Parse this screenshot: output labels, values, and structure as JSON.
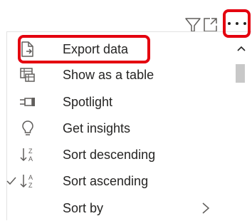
{
  "toolbar": {
    "filter_icon": "filter-icon",
    "focus_icon": "focus-mode-icon",
    "more_icon": "more-options-icon"
  },
  "menu": {
    "items": [
      {
        "label": "Export data",
        "icon": "export-data-icon"
      },
      {
        "label": "Show as a table",
        "icon": "show-as-table-icon"
      },
      {
        "label": "Spotlight",
        "icon": "spotlight-icon"
      },
      {
        "label": "Get insights",
        "icon": "lightbulb-icon"
      },
      {
        "label": "Sort descending",
        "icon": "sort-descending-icon"
      },
      {
        "label": "Sort ascending",
        "icon": "sort-ascending-icon",
        "checked": true
      },
      {
        "label": "Sort by",
        "icon": "",
        "submenu": true
      }
    ]
  },
  "colors": {
    "highlight": "#e4000f",
    "text": "#252423",
    "icon": "#605e5c",
    "scrollbar": "#c8c8c8"
  }
}
